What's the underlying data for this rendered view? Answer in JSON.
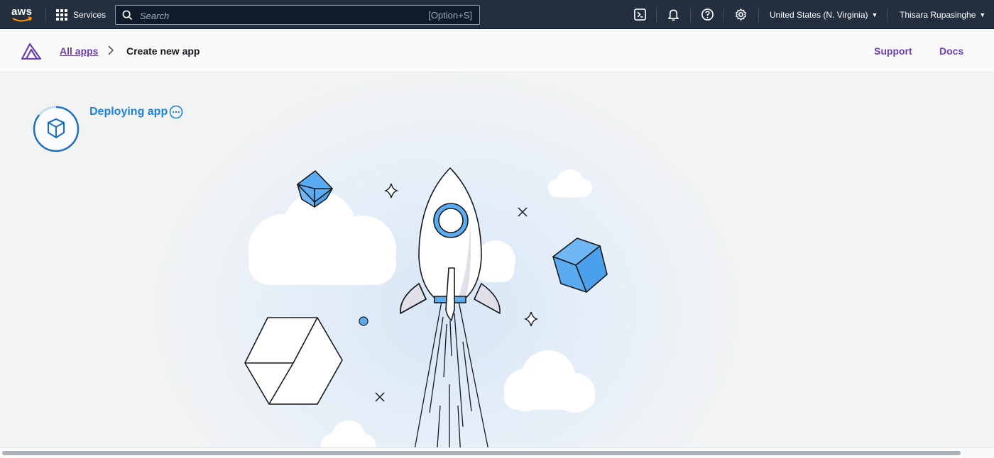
{
  "topbar": {
    "logo_text": "aws",
    "services_label": "Services",
    "search_placeholder": "Search",
    "search_value": "",
    "search_shortcut": "[Option+S]",
    "icons": [
      "cloudshell-icon",
      "bell-icon",
      "help-icon",
      "settings-icon"
    ],
    "region_label": "United States (N. Virginia)",
    "user_label": "Thisara Rupasinghe"
  },
  "app_header": {
    "breadcrumbs": [
      {
        "label": "All apps"
      },
      {
        "label": "Create new app"
      }
    ],
    "links": [
      {
        "label": "Support"
      },
      {
        "label": "Docs"
      }
    ]
  },
  "status": {
    "label": "Deploying app"
  },
  "colors": {
    "topbar_bg": "#232f3e",
    "amplify_purple": "#6b40b1",
    "status_blue": "#1e82d6",
    "cube_blue": "#5aabf0"
  }
}
